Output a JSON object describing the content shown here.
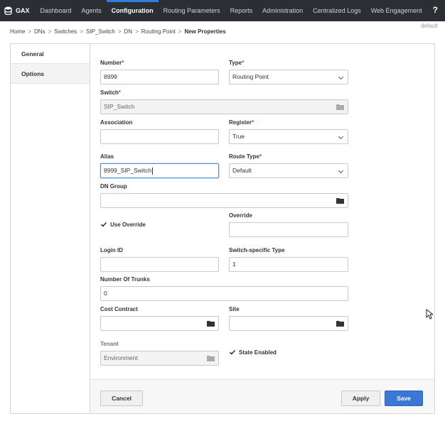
{
  "brand": {
    "name": "GAX"
  },
  "nav": [
    {
      "label": "Dashboard",
      "active": false
    },
    {
      "label": "Agents",
      "active": false
    },
    {
      "label": "Configuration",
      "active": true
    },
    {
      "label": "Routing Parameters",
      "active": false
    },
    {
      "label": "Reports",
      "active": false
    },
    {
      "label": "Administration",
      "active": false
    },
    {
      "label": "Centralized Logs",
      "active": false
    },
    {
      "label": "Web Engagement",
      "active": false
    }
  ],
  "help_label": "?",
  "profile_label": "default",
  "breadcrumb": [
    "Home",
    "DNs",
    "Switches",
    "SIP_Switch",
    "DN",
    "Routing Point",
    "New Properties"
  ],
  "breadcrumb_separator": ">",
  "tabs": [
    {
      "label": "General",
      "active": true
    },
    {
      "label": "Options",
      "active": false
    }
  ],
  "form": {
    "number": {
      "label": "Number",
      "value": "8999"
    },
    "type": {
      "label": "Type",
      "value": "Routing Point"
    },
    "switch": {
      "label": "Switch",
      "value": "SIP_Switch"
    },
    "association": {
      "label": "Association",
      "value": ""
    },
    "register": {
      "label": "Register",
      "value": "True"
    },
    "alias": {
      "label": "Alias",
      "value": "8999_SIP_Switch"
    },
    "route_type": {
      "label": "Route Type",
      "value": "Default"
    },
    "dn_group": {
      "label": "DN Group",
      "value": ""
    },
    "use_override": {
      "label": "Use Override",
      "checked": true
    },
    "override": {
      "label": "Override",
      "value": ""
    },
    "login_id": {
      "label": "Login ID",
      "value": ""
    },
    "switch_specific_type": {
      "label": "Switch-specific Type",
      "value": "1"
    },
    "number_of_trunks": {
      "label": "Number Of Trunks",
      "value": "0"
    },
    "cost_contract": {
      "label": "Cost Contract",
      "value": ""
    },
    "site": {
      "label": "Site",
      "value": ""
    },
    "tenant": {
      "label": "Tenant",
      "value": "Environment"
    },
    "state_enabled": {
      "label": "State Enabled",
      "checked": true
    },
    "required_marker": "*"
  },
  "buttons": {
    "cancel": "Cancel",
    "apply": "Apply",
    "save": "Save"
  },
  "colors": {
    "topbar": "#2b2f33",
    "accent": "#2f7ed8",
    "primary_button": "#3b77d6",
    "required": "#d9342b"
  }
}
